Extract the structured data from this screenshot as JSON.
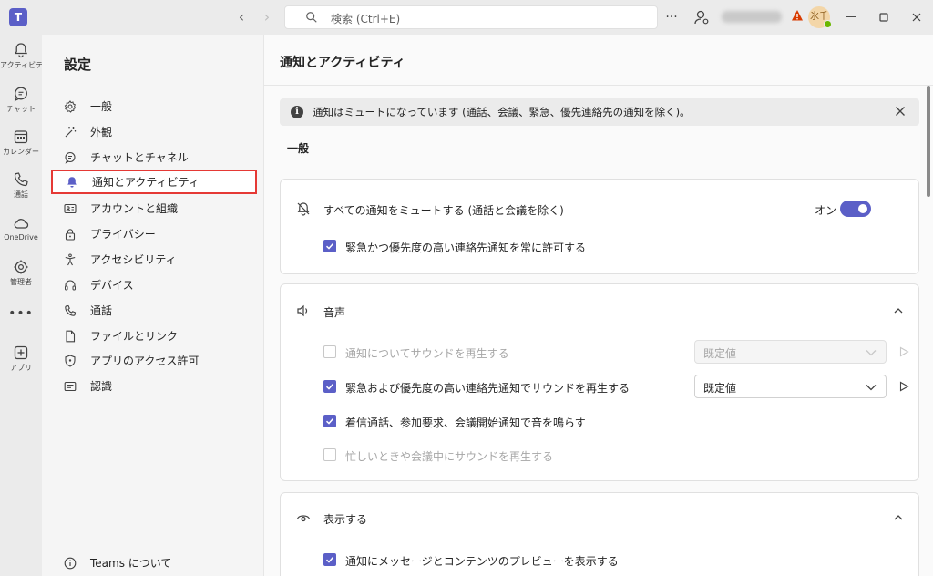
{
  "titlebar": {
    "search_placeholder": "検索 (Ctrl+E)",
    "avatar_initials": "氷千"
  },
  "rail": [
    {
      "label": "アクティビティ",
      "icon": "bell-icon"
    },
    {
      "label": "チャット",
      "icon": "chat-icon"
    },
    {
      "label": "カレンダー",
      "icon": "calendar-icon"
    },
    {
      "label": "通話",
      "icon": "phone-icon"
    },
    {
      "label": "OneDrive",
      "icon": "cloud-icon"
    },
    {
      "label": "管理者",
      "icon": "admin-icon"
    },
    {
      "label": "アプリ",
      "icon": "add-app-icon"
    }
  ],
  "settings_nav": {
    "title": "設定",
    "items": [
      {
        "label": "一般",
        "icon": "gear-icon"
      },
      {
        "label": "外観",
        "icon": "wand-icon"
      },
      {
        "label": "チャットとチャネル",
        "icon": "chat-icon"
      },
      {
        "label": "通知とアクティビティ",
        "icon": "bell-icon",
        "selected": true
      },
      {
        "label": "アカウントと組織",
        "icon": "id-card-icon"
      },
      {
        "label": "プライバシー",
        "icon": "lock-icon"
      },
      {
        "label": "アクセシビリティ",
        "icon": "accessibility-icon"
      },
      {
        "label": "デバイス",
        "icon": "headset-icon"
      },
      {
        "label": "通話",
        "icon": "phone-icon"
      },
      {
        "label": "ファイルとリンク",
        "icon": "file-icon"
      },
      {
        "label": "アプリのアクセス許可",
        "icon": "shield-icon"
      },
      {
        "label": "認識",
        "icon": "recognition-icon"
      }
    ],
    "about": "Teams について"
  },
  "main": {
    "title": "通知とアクティビティ",
    "banner": "通知はミュートになっています (通話、会議、緊急、優先連絡先の通知を除く)。",
    "general_label": "一般",
    "mute_card": {
      "mute_label": "すべての通知をミュートする (通話と会議を除く)",
      "toggle_state": "オン",
      "urgent_allow_label": "緊急かつ優先度の高い連絡先通知を常に許可する"
    },
    "sound_card": {
      "title": "音声",
      "rows": [
        {
          "label": "通知についてサウンドを再生する",
          "checked": false,
          "disabled": true,
          "select": "既定値"
        },
        {
          "label": "緊急および優先度の高い連絡先通知でサウンドを再生する",
          "checked": true,
          "disabled": false,
          "select": "既定値"
        },
        {
          "label": "着信通話、参加要求、会議開始通知で音を鳴らす",
          "checked": true,
          "disabled": false
        },
        {
          "label": "忙しいときや会議中にサウンドを再生する",
          "checked": false,
          "disabled": true
        }
      ]
    },
    "display_card": {
      "title": "表示する",
      "preview_label": "通知にメッセージとコンテンツのプレビューを表示する"
    }
  }
}
